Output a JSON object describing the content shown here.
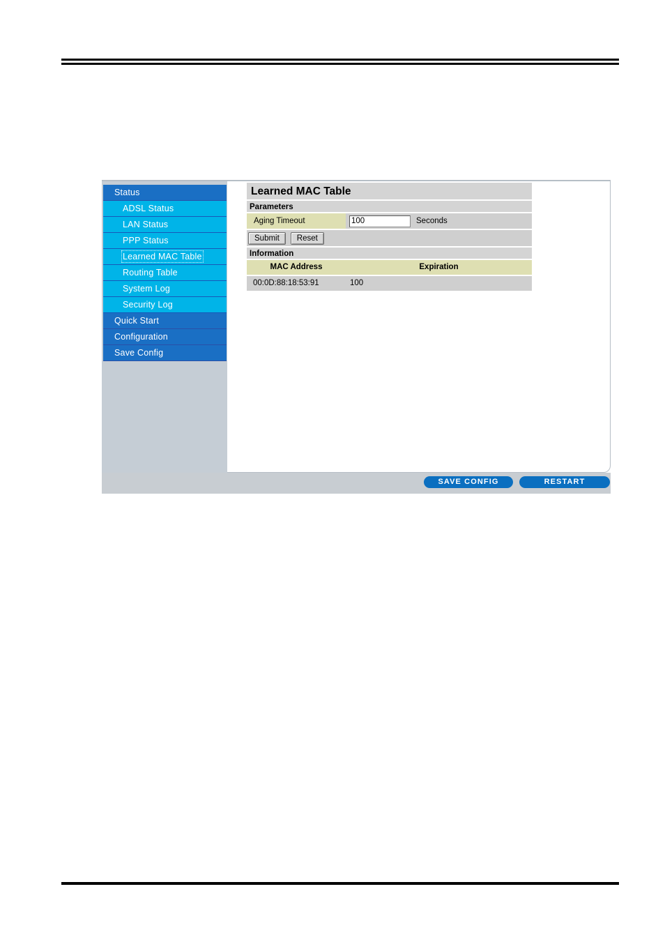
{
  "document": {
    "rules": {
      "top": "double-rule",
      "bottom": "single-rule"
    }
  },
  "sidebar": {
    "items": [
      {
        "label": "Status",
        "level": "top",
        "selected": false
      },
      {
        "label": "ADSL Status",
        "level": "sub",
        "selected": false
      },
      {
        "label": "LAN Status",
        "level": "sub",
        "selected": false
      },
      {
        "label": "PPP Status",
        "level": "sub",
        "selected": false
      },
      {
        "label": "Learned MAC Table",
        "level": "sub",
        "selected": true
      },
      {
        "label": "Routing Table",
        "level": "sub",
        "selected": false
      },
      {
        "label": "System Log",
        "level": "sub",
        "selected": false
      },
      {
        "label": "Security Log",
        "level": "sub",
        "selected": false
      },
      {
        "label": "Quick Start",
        "level": "top",
        "selected": false
      },
      {
        "label": "Configuration",
        "level": "top",
        "selected": false
      },
      {
        "label": "Save Config",
        "level": "top",
        "selected": false
      }
    ],
    "scrollbar": {
      "left_arrow_icon": "arrow-left-icon",
      "right_arrow_icon": "arrow-right-icon",
      "resize_grip_icon": "resize-grip-icon"
    }
  },
  "main": {
    "title": "Learned MAC Table",
    "parameters": {
      "heading": "Parameters",
      "aging_timeout": {
        "label": "Aging Timeout",
        "value": "100",
        "placeholder": "",
        "unit": "Seconds"
      },
      "submit_label": "Submit",
      "reset_label": "Reset"
    },
    "information": {
      "heading": "Information",
      "columns": [
        "MAC Address",
        "Expiration"
      ],
      "rows": [
        {
          "mac": "00:0D:88:18:53:91",
          "expiration": "100"
        }
      ]
    }
  },
  "footer": {
    "save_config_label": "SAVE CONFIG",
    "restart_label": "RESTART"
  },
  "colors": {
    "menu_top": "#1a6fc4",
    "menu_sub": "#00b4e8",
    "sidebar_bg": "#c5cdd5",
    "panel_header": "#d4d4d4",
    "label_cell": "#dedfb2",
    "value_cell": "#cfcfcf",
    "footer_bg": "#c8cdd2",
    "pill_blue": "#0b6fc0"
  }
}
